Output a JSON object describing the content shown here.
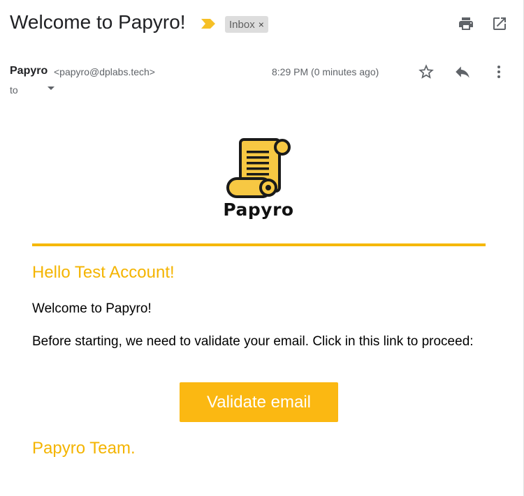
{
  "email": {
    "subject": "Welcome to Papyro!",
    "label": "Inbox",
    "label_remove": "×",
    "sender_name": "Papyro",
    "sender_email": "<papyro@dplabs.tech>",
    "to_label": "to",
    "timestamp": "8:29 PM (0 minutes ago)"
  },
  "icons": {
    "importance": "importance-marker-icon",
    "print": "print-icon",
    "open_new_window": "open-in-new-window-icon",
    "star": "star-icon",
    "reply": "reply-icon",
    "more": "more-vert-icon",
    "caret": "chevron-down-icon"
  },
  "body": {
    "logo_text": "Papyro",
    "greeting": "Hello Test Account!",
    "welcome": "Welcome to Papyro!",
    "instructions": "Before starting, we need to validate your email. Click in this link to proceed:",
    "button_label": "Validate email",
    "signoff": "Papyro Team."
  },
  "colors": {
    "accent": "#f4b400",
    "button": "#fbb812",
    "rule": "#f5b800"
  }
}
